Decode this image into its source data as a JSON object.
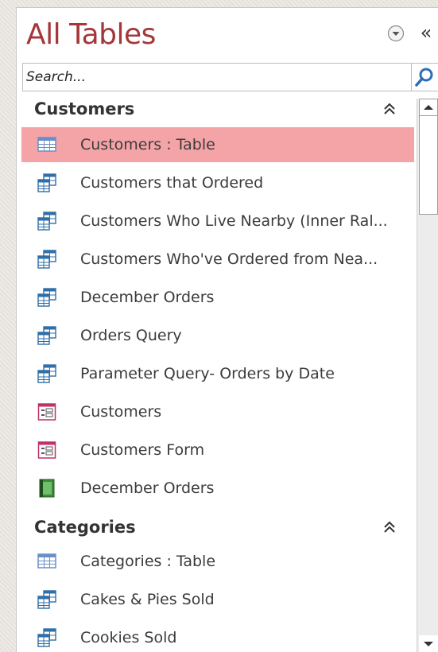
{
  "pane": {
    "title": "All Tables",
    "menu_icon": "chevron-circle-down-icon",
    "collapse_label": "«"
  },
  "search": {
    "placeholder": "Search...",
    "value": "",
    "icon": "search-icon"
  },
  "groups": [
    {
      "label": "Customers",
      "collapse_icon": "double-chevron-up-icon",
      "items": [
        {
          "label": "Customers : Table",
          "icon": "table-icon",
          "selected": true
        },
        {
          "label": "Customers that Ordered",
          "icon": "query-icon"
        },
        {
          "label": "Customers Who Live Nearby (Inner Ral...",
          "icon": "query-icon"
        },
        {
          "label": "Customers Who've Ordered from Nea...",
          "icon": "query-icon"
        },
        {
          "label": "December Orders",
          "icon": "query-icon"
        },
        {
          "label": "Orders Query",
          "icon": "query-icon"
        },
        {
          "label": "Parameter Query- Orders by Date",
          "icon": "query-icon"
        },
        {
          "label": "Customers",
          "icon": "form-icon"
        },
        {
          "label": "Customers Form",
          "icon": "form-icon"
        },
        {
          "label": "December Orders",
          "icon": "report-icon"
        }
      ]
    },
    {
      "label": "Categories",
      "collapse_icon": "double-chevron-up-icon",
      "items": [
        {
          "label": "Categories : Table",
          "icon": "table-icon"
        },
        {
          "label": "Cakes & Pies Sold",
          "icon": "query-icon"
        },
        {
          "label": "Cookies Sold",
          "icon": "query-icon"
        }
      ]
    }
  ],
  "colors": {
    "title": "#a4373a",
    "selected_bg": "#f4a4a7",
    "table_icon": "#6a8fc7",
    "query_icon": "#2f6fa8",
    "form_icon": "#c0306a",
    "report_icon": "#3f8a3a"
  }
}
